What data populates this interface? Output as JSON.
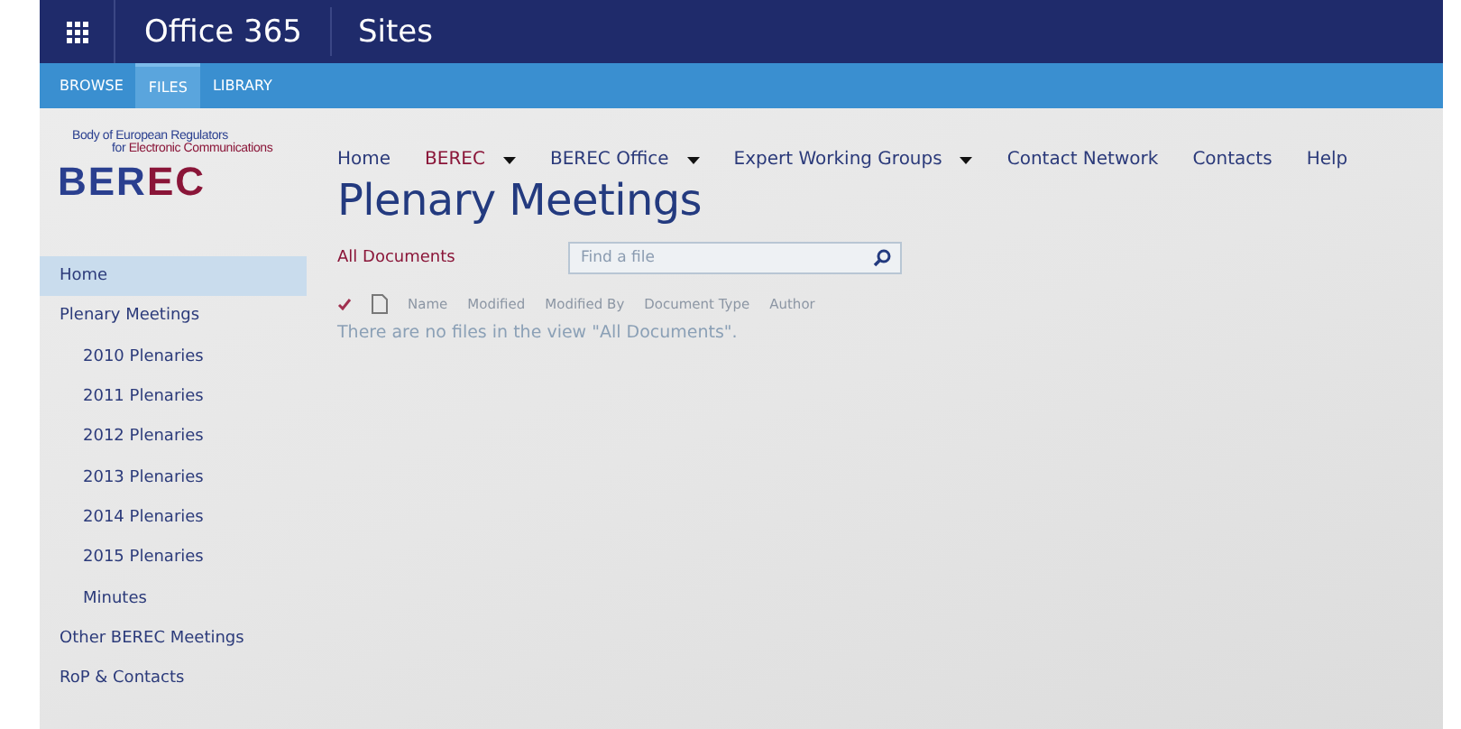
{
  "suite_bar": {
    "brand": "Office 365",
    "app": "Sites"
  },
  "ribbon_tabs": [
    {
      "label": "BROWSE",
      "selected": false
    },
    {
      "label": "FILES",
      "selected": true
    },
    {
      "label": "LIBRARY",
      "selected": false
    }
  ],
  "logo": {
    "line1": "Body of European Regulators",
    "line2_a": "for ",
    "line2_b": "Electronic Communications",
    "wordmark": [
      {
        "text": "BER",
        "color": "#2a3f8f"
      },
      {
        "text": "EC",
        "color": "#8a1538"
      }
    ]
  },
  "top_nav": [
    {
      "label": "Home",
      "selected": false,
      "dropdown": false
    },
    {
      "label": "BEREC",
      "selected": true,
      "dropdown": true
    },
    {
      "label": "BEREC Office",
      "selected": false,
      "dropdown": true
    },
    {
      "label": "Expert Working Groups",
      "selected": false,
      "dropdown": true
    },
    {
      "label": "Contact Network",
      "selected": false,
      "dropdown": false
    },
    {
      "label": "Contacts",
      "selected": false,
      "dropdown": false
    },
    {
      "label": "Help",
      "selected": false,
      "dropdown": false
    }
  ],
  "page_title": "Plenary Meetings",
  "sidebar": {
    "items": [
      {
        "label": "Home",
        "selected": true
      },
      {
        "label": "Plenary Meetings",
        "selected": false,
        "children": [
          {
            "label": "2010 Plenaries",
            "selected": false
          },
          {
            "label": "2011 Plenaries",
            "selected": false
          },
          {
            "label": "2012 Plenaries",
            "selected": false
          },
          {
            "label": "2013 Plenaries",
            "selected": false
          },
          {
            "label": "2014 Plenaries",
            "selected": false
          },
          {
            "label": "2015 Plenaries",
            "selected": false
          },
          {
            "label": "Minutes",
            "selected": false
          }
        ]
      },
      {
        "label": "Other BEREC Meetings",
        "selected": false
      },
      {
        "label": "RoP & Contacts",
        "selected": false
      }
    ]
  },
  "library": {
    "view": "All Documents",
    "search": {
      "placeholder": "Find a file"
    },
    "columns": [
      "Name",
      "Modified",
      "Modified By",
      "Document Type",
      "Author"
    ],
    "empty_message": "There are no files in the view \"All Documents\"."
  }
}
